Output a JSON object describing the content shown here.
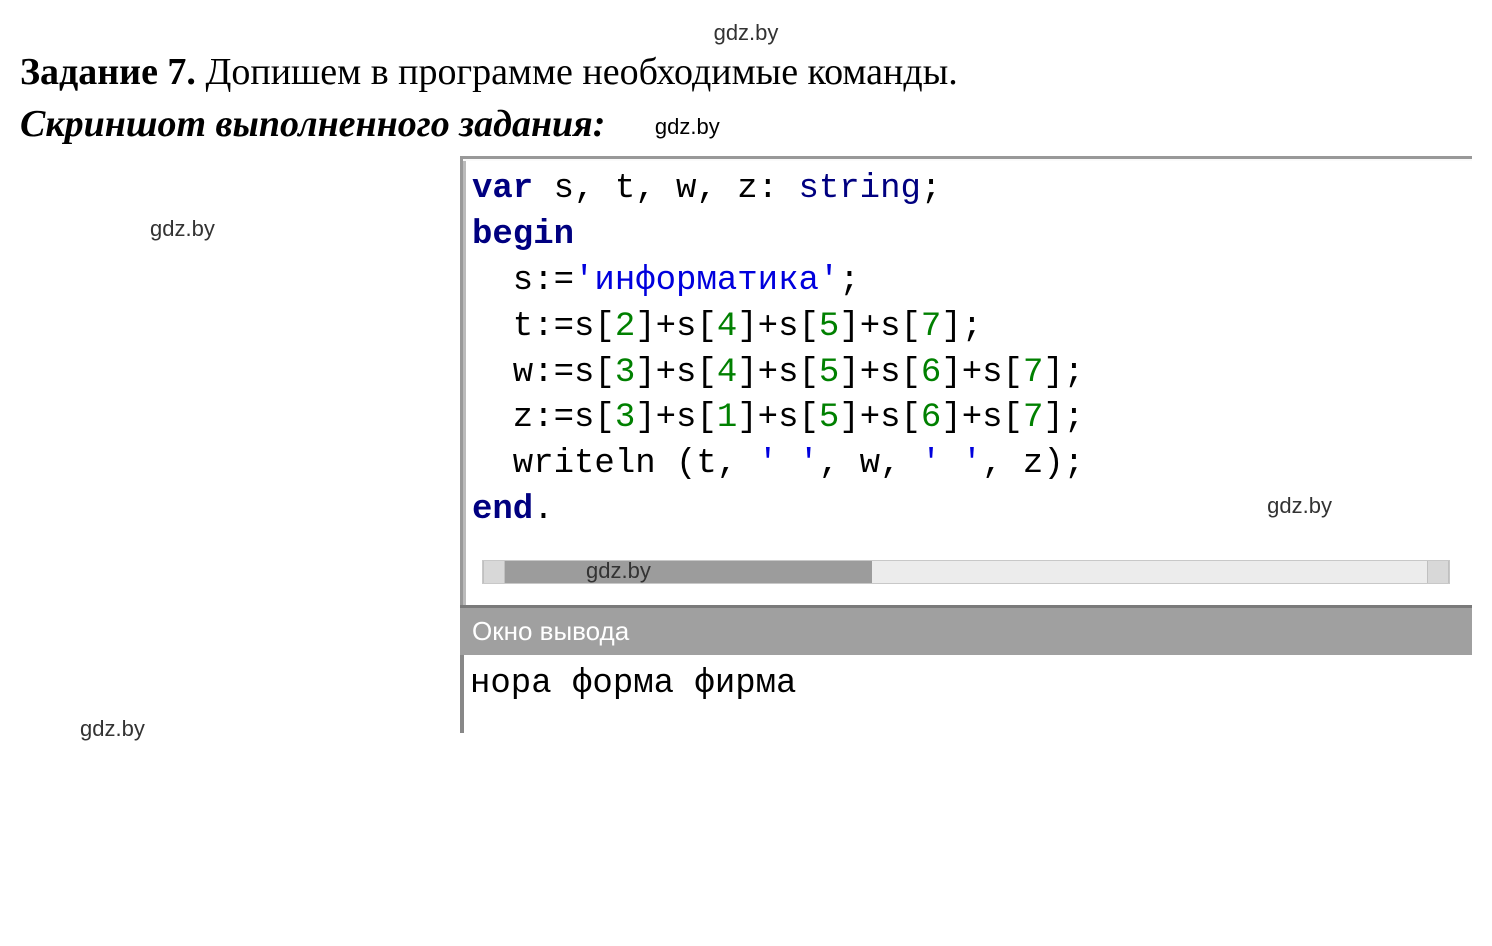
{
  "watermark": "gdz.by",
  "title": {
    "label": "Задание 7.",
    "text": "Допишем в программе необходимые команды."
  },
  "subtitle": "Скриншот выполненного задания:",
  "code": {
    "line1_var": "var",
    "line1_rest": " s, t, w, z: ",
    "line1_type": "string",
    "line1_semi": ";",
    "line2": "begin",
    "line3_pre": "  s:=",
    "line3_str": "'информатика'",
    "line3_post": ";",
    "line4_a": "  t:=s[",
    "line4_n1": "2",
    "line4_b": "]+s[",
    "line4_n2": "4",
    "line4_c": "]+s[",
    "line4_n3": "5",
    "line4_d": "]+s[",
    "line4_n4": "7",
    "line4_e": "];",
    "line5_a": "  w:=s[",
    "line5_n1": "3",
    "line5_b": "]+s[",
    "line5_n2": "4",
    "line5_c": "]+s[",
    "line5_n3": "5",
    "line5_d": "]+s[",
    "line5_n4": "6",
    "line5_e": "]+s[",
    "line5_n5": "7",
    "line5_f": "];",
    "line6_a": "  z:=s[",
    "line6_n1": "3",
    "line6_b": "]+s[",
    "line6_n2": "1",
    "line6_c": "]+s[",
    "line6_n3": "5",
    "line6_d": "]+s[",
    "line6_n4": "6",
    "line6_e": "]+s[",
    "line6_n5": "7",
    "line6_f": "];",
    "line7_a": "  writeln (t, ",
    "line7_s1": "' '",
    "line7_b": ", w, ",
    "line7_s2": "' '",
    "line7_c": ", z);",
    "line8": "end",
    "line8_dot": "."
  },
  "output": {
    "header": "Окно вывода",
    "text": "нора форма фирма"
  }
}
